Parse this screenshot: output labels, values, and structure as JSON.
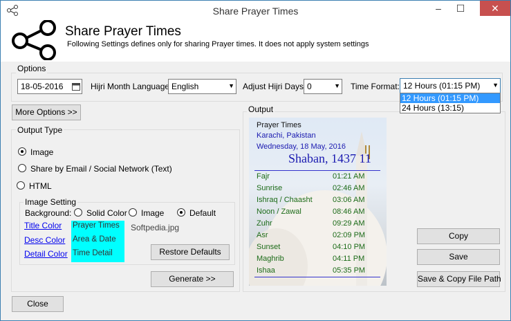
{
  "window": {
    "title": "Share Prayer Times",
    "minimize_icon": "–",
    "maximize_icon": "☐",
    "close_icon": "✕"
  },
  "header": {
    "title": "Share Prayer Times",
    "subtitle": "Following Settings defines only for sharing Prayer times. It does not apply system settings"
  },
  "options": {
    "label": "Options",
    "date_value": "18-05-2016",
    "hijri_lang_label": "Hijri Month Language:",
    "hijri_lang_value": "English",
    "adjust_label": "Adjust Hijri Days:",
    "adjust_value": "0",
    "time_format_label": "Time Format:",
    "time_format_value": "12 Hours (01:15 PM)",
    "time_format_options": [
      "12 Hours (01:15 PM)",
      "24 Hours (13:15)"
    ]
  },
  "more_options_label": "More Options >>",
  "output_type": {
    "label": "Output Type",
    "image_label": "Image",
    "share_label": "Share by Email / Social Network (Text)",
    "html_label": "HTML",
    "selected": "Image"
  },
  "image_setting": {
    "label": "Image Setting",
    "background_label": "Background:",
    "solid_color_label": "Solid Color",
    "image_label": "Image",
    "default_label": "Default",
    "selected": "Default",
    "title_color_label": "Title Color",
    "desc_color_label": "Desc Color",
    "detail_color_label": "Detail Color",
    "swatch_title": "Prayer Times",
    "swatch_area": "Area & Date",
    "swatch_time": "Time Detail",
    "swatch_color": "#00ffff",
    "file_name": "Softpedia.jpg",
    "restore_label": "Restore Defaults"
  },
  "generate_label": "Generate >>",
  "close_label": "Close",
  "output": {
    "label": "Output",
    "title": "Prayer Times",
    "location": "Karachi, Pakistan",
    "date": "Wednesday, 18 May, 2016",
    "hijri": "Shaban, 1437 11",
    "prayers": [
      {
        "name": "Fajr",
        "time": "01:21 AM"
      },
      {
        "name": "Sunrise",
        "time": "02:46 AM"
      },
      {
        "name": "Ishraq / Chaasht",
        "time": "03:06 AM"
      },
      {
        "name": "Noon / Zawal",
        "time": "08:46 AM"
      },
      {
        "name": "Zuhr",
        "time": "09:29 AM"
      },
      {
        "name": "Asr",
        "time": "02:09 PM"
      },
      {
        "name": "Sunset",
        "time": "04:10 PM"
      },
      {
        "name": "Maghrib",
        "time": "04:11 PM"
      },
      {
        "name": "Ishaa",
        "time": "05:35 PM"
      }
    ]
  },
  "actions": {
    "copy_label": "Copy",
    "save_label": "Save",
    "save_copy_label": "Save & Copy File Path"
  }
}
